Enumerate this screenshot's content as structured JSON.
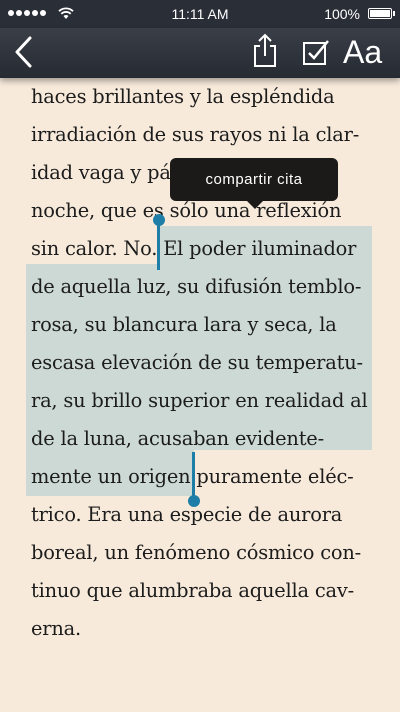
{
  "status_bar": {
    "time": "11:11 AM",
    "battery_percent": "100%",
    "battery_level": 1.0,
    "signal_bars": 5,
    "icons": [
      "signal-dots-icon",
      "wifi-icon",
      "battery-icon"
    ]
  },
  "toolbar": {
    "font_label": "Aa",
    "icons": [
      "back-chevron-icon",
      "share-icon",
      "checkbox-icon"
    ]
  },
  "tooltip": {
    "label": "compartir cita"
  },
  "reader": {
    "lines": [
      "haces brillantes y la espléndida",
      "irradiación de sus rayos ni la clar-",
      "idad vaga y pálida de la luna, a",
      "noche, que es sólo una reflexión",
      "sin calor. No. El poder iluminador",
      "de aquella luz, su difusión temblo-",
      "rosa, su blancura lara y seca, la",
      "escasa elevación de su temperatu-",
      "ra, su brillo superior en realidad al",
      "de la luna, acusaban evidente-",
      "mente un origen puramente eléc-",
      "trico. Era una especie de aurora",
      "boreal, un fenómeno cósmico con-",
      "tinuo que alumbraba aquella cav-",
      "erna."
    ]
  },
  "colors": {
    "page_background": "#f7eadb",
    "toolbar": "#2f333b",
    "selection": "#cdd9d4",
    "handle": "#1f7ea8",
    "tooltip": "#1b1a18"
  }
}
